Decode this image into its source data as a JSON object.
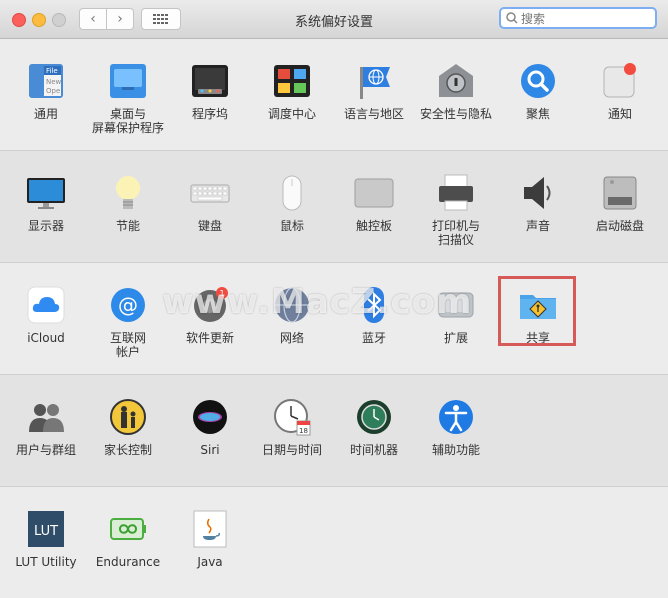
{
  "window": {
    "title": "系统偏好设置",
    "search_placeholder": "搜索"
  },
  "rows": [
    [
      {
        "label": "通用",
        "icon": "general-icon"
      },
      {
        "label": "桌面与\n屏幕保护程序",
        "icon": "desktop-icon"
      },
      {
        "label": "程序坞",
        "icon": "dock-icon"
      },
      {
        "label": "调度中心",
        "icon": "mission-control-icon"
      },
      {
        "label": "语言与地区",
        "icon": "language-icon"
      },
      {
        "label": "安全性与隐私",
        "icon": "security-icon"
      },
      {
        "label": "聚焦",
        "icon": "spotlight-icon"
      },
      {
        "label": "通知",
        "icon": "notifications-icon"
      }
    ],
    [
      {
        "label": "显示器",
        "icon": "display-icon"
      },
      {
        "label": "节能",
        "icon": "energy-icon"
      },
      {
        "label": "键盘",
        "icon": "keyboard-icon"
      },
      {
        "label": "鼠标",
        "icon": "mouse-icon"
      },
      {
        "label": "触控板",
        "icon": "trackpad-icon"
      },
      {
        "label": "打印机与\n扫描仪",
        "icon": "printer-icon"
      },
      {
        "label": "声音",
        "icon": "sound-icon"
      },
      {
        "label": "启动磁盘",
        "icon": "startup-disk-icon"
      }
    ],
    [
      {
        "label": "iCloud",
        "icon": "icloud-icon"
      },
      {
        "label": "互联网\n帐户",
        "icon": "internet-accounts-icon"
      },
      {
        "label": "软件更新",
        "icon": "software-update-icon",
        "badge": "1"
      },
      {
        "label": "网络",
        "icon": "network-icon"
      },
      {
        "label": "蓝牙",
        "icon": "bluetooth-icon"
      },
      {
        "label": "扩展",
        "icon": "extensions-icon"
      },
      {
        "label": "共享",
        "icon": "sharing-icon"
      }
    ],
    [
      {
        "label": "用户与群组",
        "icon": "users-icon"
      },
      {
        "label": "家长控制",
        "icon": "parental-controls-icon"
      },
      {
        "label": "Siri",
        "icon": "siri-icon"
      },
      {
        "label": "日期与时间",
        "icon": "date-time-icon",
        "date": "18"
      },
      {
        "label": "时间机器",
        "icon": "time-machine-icon"
      },
      {
        "label": "辅助功能",
        "icon": "accessibility-icon"
      }
    ],
    [
      {
        "label": "LUT Utility",
        "icon": "lut-utility-icon",
        "text": "LUT"
      },
      {
        "label": "Endurance",
        "icon": "endurance-icon"
      },
      {
        "label": "Java",
        "icon": "java-icon"
      }
    ]
  ],
  "general_icon_text": [
    "File",
    "New",
    "Ope"
  ],
  "watermark": "www.MacZ.com",
  "colors": {
    "highlight": "#d65b58",
    "search_focus": "#7eaef2"
  }
}
